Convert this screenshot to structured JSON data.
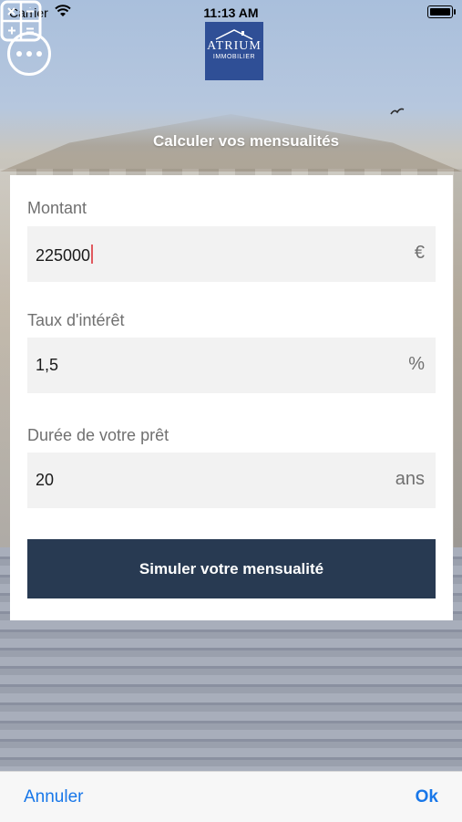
{
  "status_bar": {
    "carrier": "Carrier",
    "time": "11:13 AM"
  },
  "header": {
    "logo_name": "ATRIUM",
    "logo_subtitle": "IMMOBILIER",
    "section_title": "Calculer vos mensualités"
  },
  "form": {
    "amount": {
      "label": "Montant",
      "value": "225000",
      "unit": "€"
    },
    "rate": {
      "label": "Taux d'intérêt",
      "value": "1,5",
      "unit": "%"
    },
    "duration": {
      "label": "Durée de votre prêt",
      "value": "20",
      "unit": "ans"
    },
    "submit_label": "Simuler votre mensualité"
  },
  "toolbar": {
    "cancel_label": "Annuler",
    "ok_label": "Ok"
  },
  "colors": {
    "button_bg": "#283a52",
    "toolbar_link": "#1877e9",
    "logo_bg": "#2f4f96",
    "caret": "#e0595f"
  },
  "icons": [
    "wifi-icon",
    "battery-icon",
    "more-icon",
    "calculator-icon"
  ]
}
